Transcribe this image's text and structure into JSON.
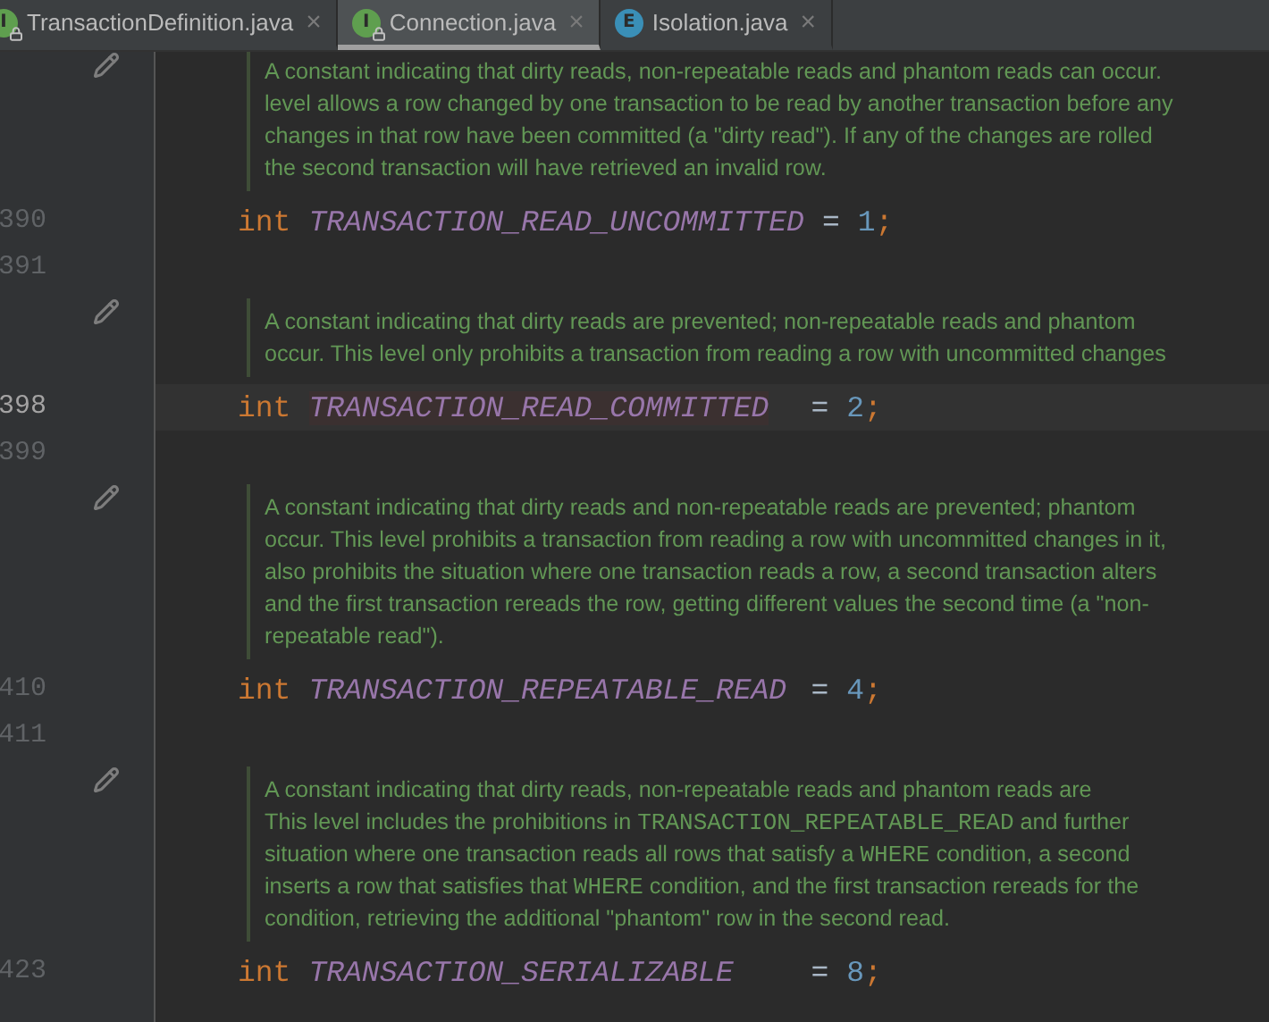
{
  "tabs": [
    {
      "icon_letter": "I",
      "color": "#5f9f4f",
      "locked": true,
      "label": "TransactionDefinition.java",
      "close": "×",
      "selected": false
    },
    {
      "icon_letter": "I",
      "color": "#5f9f4f",
      "locked": true,
      "label": "Connection.java",
      "close": "×",
      "selected": true
    },
    {
      "icon_letter": "E",
      "color": "#3a8fb7",
      "locked": false,
      "label": "Isolation.java",
      "close": "×",
      "selected": false
    }
  ],
  "lines": [
    {
      "kind": "doc",
      "lines": [
        [
          {
            "text": "A constant indicating that dirty reads, non-repeatable reads and phantom reads can occur."
          }
        ],
        [
          {
            "text": "level allows a row changed by one transaction to be read by another transaction before any"
          }
        ],
        [
          {
            "text": "changes in that row have been committed (a \"dirty read\"). If any of the changes are rolled"
          }
        ],
        [
          {
            "text": "the second transaction will have retrieved an invalid row."
          }
        ]
      ]
    },
    {
      "kind": "code",
      "number": "390",
      "current": false,
      "type": "int",
      "name": "TRANSACTION_READ_UNCOMMITTED",
      "highlighted": false,
      "op": "=",
      "value": "1",
      "end": ";"
    },
    {
      "kind": "blank",
      "number": "391",
      "current": false
    },
    {
      "kind": "doc",
      "lines": [
        [
          {
            "text": "A constant indicating that dirty reads are prevented; non-repeatable reads and phantom"
          }
        ],
        [
          {
            "text": "occur. This level only prohibits a transaction from reading a row with uncommitted changes"
          }
        ]
      ]
    },
    {
      "kind": "code",
      "number": "398",
      "current": true,
      "type": "int",
      "name": "TRANSACTION_READ_COMMITTED",
      "highlighted": true,
      "op": "=",
      "value": "2",
      "end": ";"
    },
    {
      "kind": "blank",
      "number": "399",
      "current": false
    },
    {
      "kind": "doc",
      "lines": [
        [
          {
            "text": "A constant indicating that dirty reads and non-repeatable reads are prevented; phantom"
          }
        ],
        [
          {
            "text": "occur. This level prohibits a transaction from reading a row with uncommitted changes in it,"
          }
        ],
        [
          {
            "text": "also prohibits the situation where one transaction reads a row, a second transaction alters"
          }
        ],
        [
          {
            "text": "and the first transaction rereads the row, getting different values the second time (a \"non-"
          }
        ],
        [
          {
            "text": "repeatable read\")."
          }
        ]
      ]
    },
    {
      "kind": "code",
      "number": "410",
      "current": false,
      "type": "int",
      "name": "TRANSACTION_REPEATABLE_READ",
      "highlighted": false,
      "op": "=",
      "value": "4",
      "end": ";"
    },
    {
      "kind": "blank",
      "number": "411",
      "current": false
    },
    {
      "kind": "doc",
      "lines": [
        [
          {
            "text": "A constant indicating that dirty reads, non-repeatable reads and phantom reads are"
          }
        ],
        [
          {
            "text": "This level includes the prohibitions in "
          },
          {
            "text": "TRANSACTION_REPEATABLE_READ",
            "code": true
          },
          {
            "text": " and further"
          }
        ],
        [
          {
            "text": "situation where one transaction reads all rows that satisfy a "
          },
          {
            "text": "WHERE",
            "code": true
          },
          {
            "text": " condition, a second"
          }
        ],
        [
          {
            "text": "inserts a row that satisfies that "
          },
          {
            "text": "WHERE",
            "code": true
          },
          {
            "text": " condition, and the first transaction rereads for the"
          }
        ],
        [
          {
            "text": "condition, retrieving the additional \"phantom\" row in the second read."
          }
        ]
      ]
    },
    {
      "kind": "code",
      "number": "423",
      "current": false,
      "type": "int",
      "name": "TRANSACTION_SERIALIZABLE",
      "highlighted": false,
      "op": "=",
      "value": "8",
      "end": ";"
    }
  ]
}
